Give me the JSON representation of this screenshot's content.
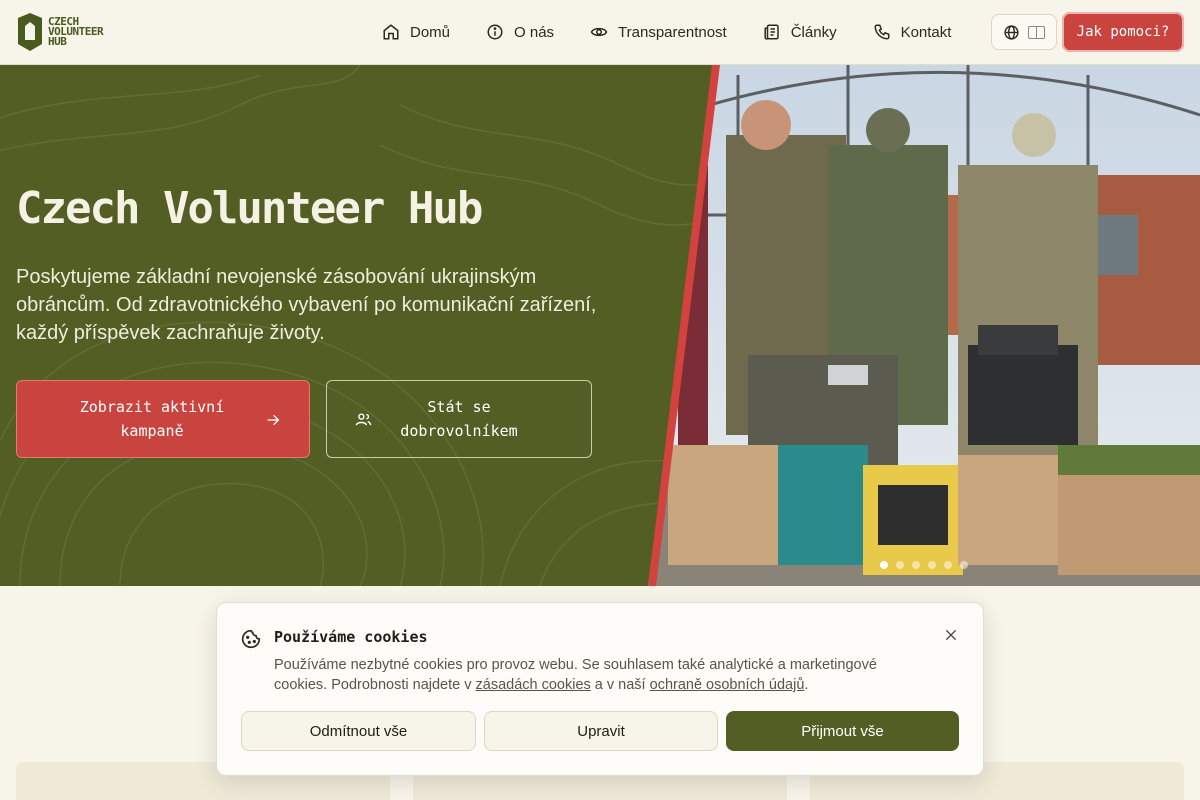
{
  "logo": {
    "line1": "CZECH",
    "line2": "VOLUNTEER",
    "line3": "HUB"
  },
  "nav": {
    "items": [
      {
        "label": "Domů",
        "icon": "home-icon"
      },
      {
        "label": "O nás",
        "icon": "info-icon"
      },
      {
        "label": "Transparentnost",
        "icon": "eye-icon"
      },
      {
        "label": "Články",
        "icon": "articles-icon"
      },
      {
        "label": "Kontakt",
        "icon": "phone-icon"
      }
    ],
    "language_icon": "globe-icon",
    "help_label": "Jak pomoci?"
  },
  "hero": {
    "title": "Czech Volunteer Hub",
    "subtitle": "Poskytujeme základní nevojenské zásobování ukrajinským obráncům. Od zdravotnického vybavení po komunikační zařízení, každý příspěvek zachraňuje životy.",
    "primary_button": "Zobrazit aktivní\nkampaně",
    "secondary_button": "Stát se\ndobrovolníkem",
    "carousel": {
      "slides": 6,
      "active": 1
    }
  },
  "cookie": {
    "title": "Používáme cookies",
    "text_before": "Používáme nezbytné cookies pro provoz webu. Se souhlasem také analytické a marketingové cookies. Podrobnosti najdete v ",
    "link1": "zásadách cookies",
    "text_middle": " a v naší ",
    "link2": "ochraně osobních údajů",
    "text_after": ".",
    "reject": "Odmítnout vše",
    "customize": "Upravit",
    "accept": "Přijmout vše"
  },
  "colors": {
    "olive": "#525e23",
    "red": "#c9443f",
    "cream": "#f7f4ea"
  }
}
